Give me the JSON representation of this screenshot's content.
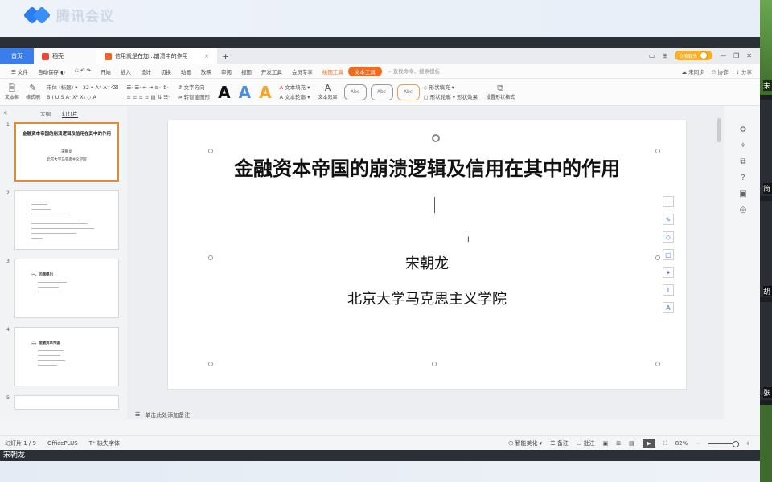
{
  "meeting": {
    "logo_text": "腾讯会议",
    "presenter_name": "宋朝龙",
    "participants": [
      "宋",
      "简",
      "胡",
      "张"
    ]
  },
  "tabs": [
    {
      "label": "首页"
    },
    {
      "label": "稻壳"
    },
    {
      "label": "信用就是在加...崩溃中的作用"
    }
  ],
  "window_right": {
    "user": "0领取头"
  },
  "menu": {
    "items": [
      "文件",
      "自动保存",
      "开始",
      "插入",
      "设计",
      "切换",
      "动画",
      "放映",
      "审阅",
      "视图",
      "开发工具",
      "会员专享",
      "绘图工具",
      "文本工具"
    ],
    "search": "查找命令、搜索模板",
    "right": [
      "未同步",
      "协作",
      "分享"
    ]
  },
  "ribbon": {
    "textbox": "文本框",
    "format_painter": "格式刷",
    "font_name": "宋体 (标题)",
    "font_size": "32",
    "text_direction": "文字方向",
    "convert_smartart": "转智能图形",
    "text_fill": "文本填充",
    "text_outline": "文本轮廓",
    "text_effect": "文本效果",
    "style1": "Abc",
    "style2": "Abc",
    "style3": "Abc",
    "shape_fill": "形状填充",
    "shape_outline": "形状轮廓",
    "shape_effect": "形状效果",
    "arrange": "设置形状格式"
  },
  "sidebar": {
    "tab_outline": "大纲",
    "tab_slides": "幻灯片",
    "thumbs": [
      {
        "num": "1",
        "title": "金融资本帝国的崩溃逻辑及信用在其中的作用",
        "author": "宋朝龙",
        "inst": "北京大学马克思主义学院"
      },
      {
        "num": "2"
      },
      {
        "num": "3",
        "head": "一、问题提出"
      },
      {
        "num": "4",
        "head": "二、金融资本帝国"
      },
      {
        "num": "5"
      }
    ],
    "add": "+"
  },
  "slide": {
    "title": "金融资本帝国的崩溃逻辑及信用在其中的作用",
    "author": "宋朝龙",
    "institution": "北京大学马克思主义学院"
  },
  "notes_placeholder": "单击此处添加备注",
  "status": {
    "slide_counter": "幻灯片 1 / 9",
    "plugin": "OfficePLUS",
    "missing_font": "缺失字体",
    "beautify": "智能美化",
    "notes": "备注",
    "comments": "批注",
    "zoom": "82%"
  },
  "colors": {
    "accent": "#f26a1b",
    "tab_blue": "#3b7ded",
    "selection_border": "#e08b3a"
  }
}
